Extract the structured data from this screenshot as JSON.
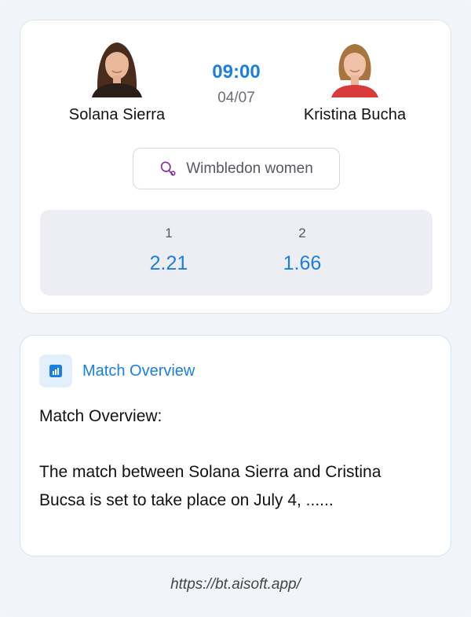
{
  "match": {
    "player1": {
      "name": "Solana Sierra"
    },
    "player2": {
      "name": "Kristina Bucha"
    },
    "time": "09:00",
    "date": "04/07",
    "tournament": {
      "label": "Wimbledon women",
      "icon": "tennis-racket-icon"
    },
    "odds": [
      {
        "label": "1",
        "value": "2.21"
      },
      {
        "label": "2",
        "value": "1.66"
      }
    ]
  },
  "overview": {
    "title": "Match Overview",
    "icon": "bar-chart-icon",
    "text": "Match Overview:\n\nThe match between Solana Sierra and Cristina Bucsa is set to take place on July 4, ......"
  },
  "footer": {
    "url": "https://bt.aisoft.app/"
  },
  "colors": {
    "accent": "#1a7fe0",
    "tournament_icon": "#8a2aa3",
    "background": "#f1f5fa"
  }
}
